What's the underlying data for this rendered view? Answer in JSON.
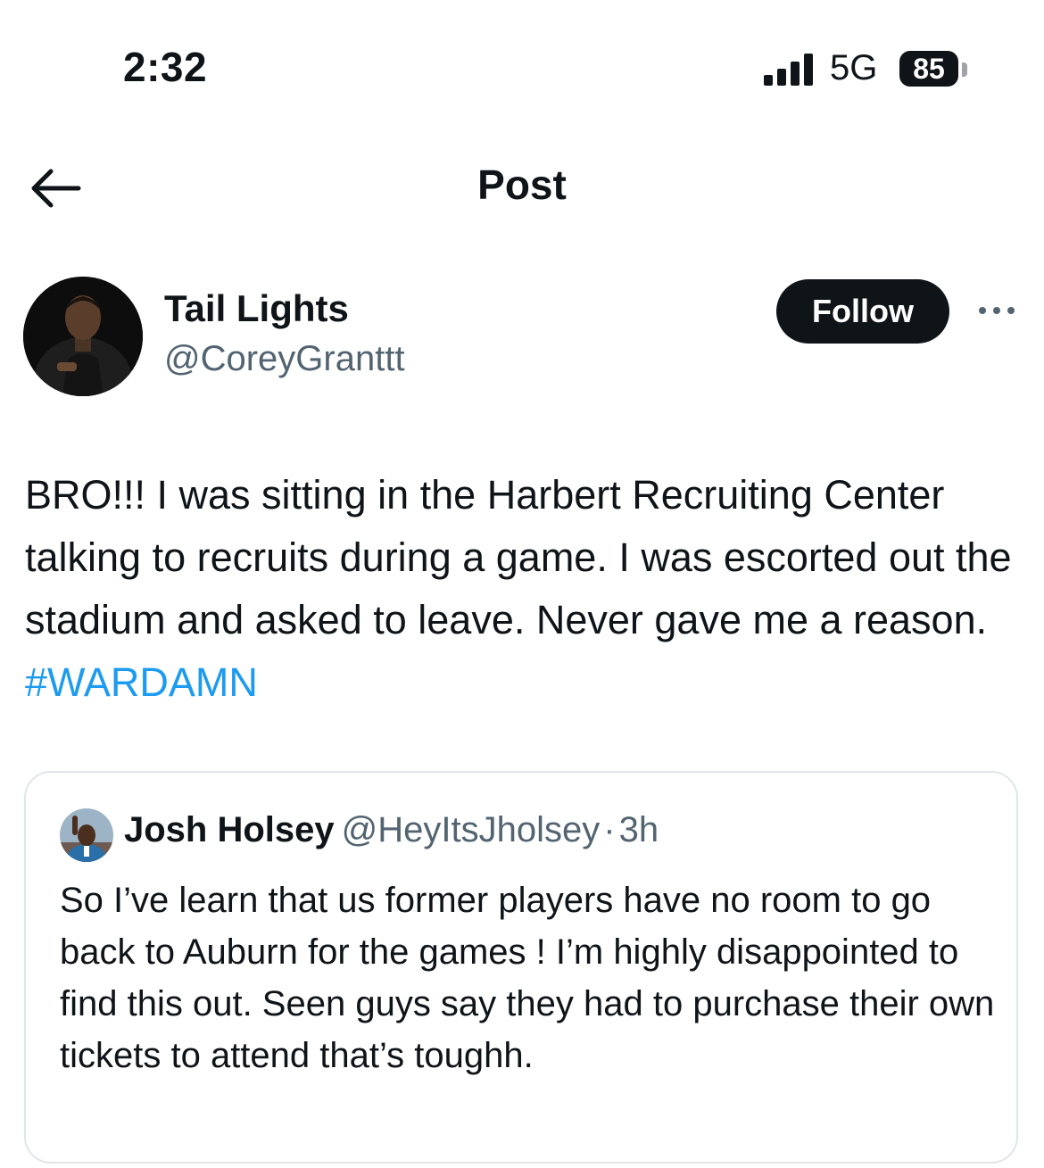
{
  "status_bar": {
    "time": "2:32",
    "network": "5G",
    "battery": "85"
  },
  "nav": {
    "title": "Post"
  },
  "post": {
    "author": {
      "display_name": "Tail Lights",
      "handle": "@CoreyGranttt"
    },
    "follow_label": "Follow",
    "text": "BRO!!! I was sitting in the Harbert Recruiting Center talking to recruits during a game. I was escorted out the stadium and asked to leave. Never gave me a reason. ",
    "hashtag": "#WARDAMN"
  },
  "quote": {
    "display_name": "Josh Holsey",
    "handle": "@HeyItsJholsey",
    "separator": "·",
    "time": "3h",
    "text": "So I’ve learn that us former players have no room to go back to Auburn for the games ! I’m highly disappointed to find this out.  Seen guys say they had to purchase their own tickets to attend that’s toughh."
  },
  "colors": {
    "accent": "#1d9bf0",
    "text": "#0f1419",
    "secondary": "#536471"
  }
}
